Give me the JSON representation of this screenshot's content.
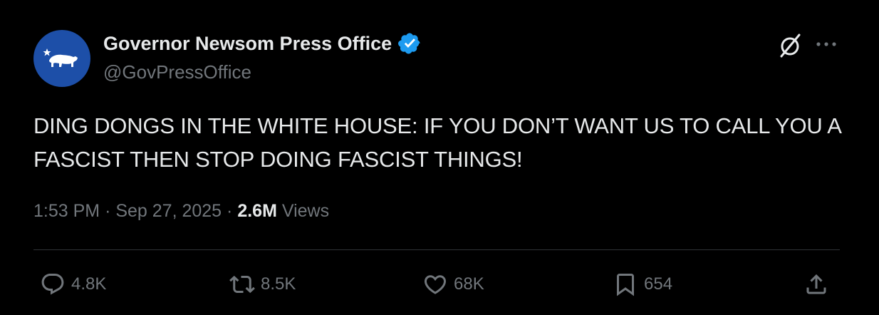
{
  "account": {
    "display_name": "Governor Newsom Press Office",
    "handle": "@GovPressOffice"
  },
  "tweet": {
    "text": "DING DONGS IN THE WHITE HOUSE: IF YOU DON’T WANT US TO CALL YOU A FASCIST THEN STOP DOING FASCIST THINGS!",
    "time": "1:53 PM",
    "date": "Sep 27, 2025",
    "separator": "·",
    "views_count": "2.6M",
    "views_label": "Views"
  },
  "actions": {
    "replies": "4.8K",
    "reposts": "8.5K",
    "likes": "68K",
    "bookmarks": "654"
  },
  "icons": {
    "avatar": "california-bear-flag-icon",
    "verified": "verified-badge-icon",
    "grok": "grok-icon",
    "more": "more-dots-icon",
    "reply": "reply-icon",
    "repost": "repost-icon",
    "like": "heart-icon",
    "bookmark": "bookmark-icon",
    "share": "share-icon"
  },
  "colors": {
    "background": "#000000",
    "primary_text": "#e7e9ea",
    "secondary_text": "#71767b",
    "divider": "#2f3336",
    "avatar_bg": "#1d4fa8",
    "verified_badge": "#1d9bf0"
  }
}
